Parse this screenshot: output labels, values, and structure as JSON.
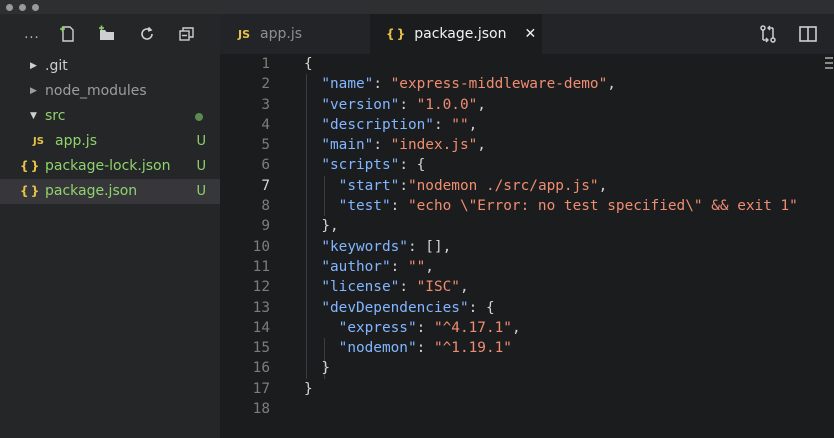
{
  "sidebar": {
    "toolbar": {
      "more_label": "...",
      "icons": [
        "new-file-icon",
        "new-folder-icon",
        "refresh-icon",
        "collapse-all-icon"
      ]
    },
    "items": [
      {
        "name": ".git",
        "type": "folder",
        "expanded": false,
        "badge": "",
        "color": "#cfcfcf"
      },
      {
        "name": "node_modules",
        "type": "folder",
        "expanded": false,
        "badge": "",
        "color": "#9d9d9d"
      },
      {
        "name": "src",
        "type": "folder",
        "expanded": true,
        "badge": "dot",
        "color": "#8fd36c"
      },
      {
        "name": "app.js",
        "type": "js",
        "icon_text": "JS",
        "badge": "U",
        "color": "#8fd36c"
      },
      {
        "name": "package-lock.json",
        "type": "json",
        "icon_text": "{ }",
        "badge": "U",
        "color": "#8fd36c"
      },
      {
        "name": "package.json",
        "type": "json",
        "icon_text": "{ }",
        "badge": "U",
        "color": "#8fd36c",
        "selected": true
      }
    ]
  },
  "tabs": [
    {
      "label": "app.js",
      "icon_text": "JS",
      "active": false
    },
    {
      "label": "package.json",
      "icon_text": "{ }",
      "active": true,
      "close_label": "✕"
    }
  ],
  "editor_actions": [
    "compare-changes-icon",
    "split-editor-icon"
  ],
  "code": {
    "current_line": 7,
    "lines": [
      "{",
      "  \"name\": \"express-middleware-demo\",",
      "  \"version\": \"1.0.0\",",
      "  \"description\": \"\",",
      "  \"main\": \"index.js\",",
      "  \"scripts\": {",
      "    \"start\":\"nodemon ./src/app.js\",",
      "    \"test\": \"echo \\\"Error: no test specified\\\" && exit 1\"",
      "  },",
      "  \"keywords\": [],",
      "  \"author\": \"\",",
      "  \"license\": \"ISC\",",
      "  \"devDependencies\": {",
      "    \"express\": \"^4.17.1\",",
      "    \"nodemon\": \"^1.19.1\"",
      "  }",
      "}",
      ""
    ]
  },
  "colors": {
    "key": "#82b6ff",
    "string": "#f08d71",
    "punct": "#d4d4d4",
    "untracked": "#8fd36c",
    "icon_yellow": "#e7c347"
  }
}
